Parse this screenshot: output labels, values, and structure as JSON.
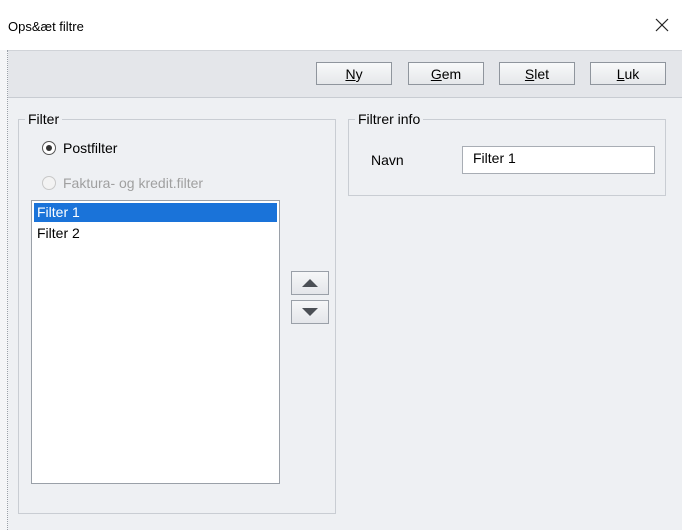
{
  "window": {
    "title": "Ops&æt filtre"
  },
  "toolbar": {
    "buttons": [
      {
        "label": "Ny",
        "mnemonic": "N",
        "rest": "y"
      },
      {
        "label": "Gem",
        "mnemonic": "G",
        "rest": "em"
      },
      {
        "label": "Slet",
        "mnemonic": "S",
        "rest": "let"
      },
      {
        "label": "Luk",
        "mnemonic": "L",
        "rest": "uk"
      }
    ]
  },
  "filter_group": {
    "label": "Filter",
    "radio_postfilter": "Postfilter",
    "radio_faktura": "Faktura- og kredit.filter",
    "selected_radio": "Postfilter",
    "items": [
      "Filter 1",
      "Filter 2"
    ],
    "selected_item": "Filter 1"
  },
  "info_group": {
    "label": "Filtrer info",
    "name_label": "Navn",
    "name_value": "Filter 1"
  },
  "icons": {
    "close": "close-icon",
    "up": "arrow-up-icon",
    "down": "arrow-down-icon"
  },
  "colors": {
    "selection": "#1a73d9",
    "panel": "#eef0f3"
  }
}
